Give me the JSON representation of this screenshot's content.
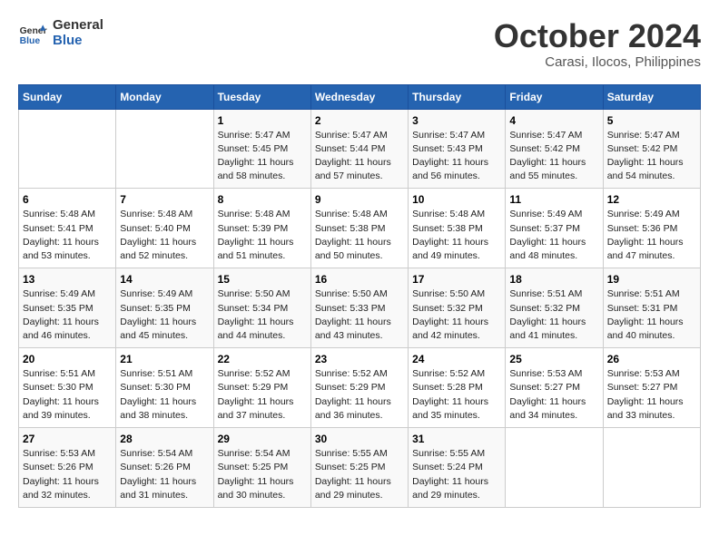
{
  "header": {
    "logo_line1": "General",
    "logo_line2": "Blue",
    "month_title": "October 2024",
    "location": "Carasi, Ilocos, Philippines"
  },
  "weekdays": [
    "Sunday",
    "Monday",
    "Tuesday",
    "Wednesday",
    "Thursday",
    "Friday",
    "Saturday"
  ],
  "weeks": [
    [
      {
        "day": "",
        "info": ""
      },
      {
        "day": "",
        "info": ""
      },
      {
        "day": "1",
        "info": "Sunrise: 5:47 AM\nSunset: 5:45 PM\nDaylight: 11 hours\nand 58 minutes."
      },
      {
        "day": "2",
        "info": "Sunrise: 5:47 AM\nSunset: 5:44 PM\nDaylight: 11 hours\nand 57 minutes."
      },
      {
        "day": "3",
        "info": "Sunrise: 5:47 AM\nSunset: 5:43 PM\nDaylight: 11 hours\nand 56 minutes."
      },
      {
        "day": "4",
        "info": "Sunrise: 5:47 AM\nSunset: 5:42 PM\nDaylight: 11 hours\nand 55 minutes."
      },
      {
        "day": "5",
        "info": "Sunrise: 5:47 AM\nSunset: 5:42 PM\nDaylight: 11 hours\nand 54 minutes."
      }
    ],
    [
      {
        "day": "6",
        "info": "Sunrise: 5:48 AM\nSunset: 5:41 PM\nDaylight: 11 hours\nand 53 minutes."
      },
      {
        "day": "7",
        "info": "Sunrise: 5:48 AM\nSunset: 5:40 PM\nDaylight: 11 hours\nand 52 minutes."
      },
      {
        "day": "8",
        "info": "Sunrise: 5:48 AM\nSunset: 5:39 PM\nDaylight: 11 hours\nand 51 minutes."
      },
      {
        "day": "9",
        "info": "Sunrise: 5:48 AM\nSunset: 5:38 PM\nDaylight: 11 hours\nand 50 minutes."
      },
      {
        "day": "10",
        "info": "Sunrise: 5:48 AM\nSunset: 5:38 PM\nDaylight: 11 hours\nand 49 minutes."
      },
      {
        "day": "11",
        "info": "Sunrise: 5:49 AM\nSunset: 5:37 PM\nDaylight: 11 hours\nand 48 minutes."
      },
      {
        "day": "12",
        "info": "Sunrise: 5:49 AM\nSunset: 5:36 PM\nDaylight: 11 hours\nand 47 minutes."
      }
    ],
    [
      {
        "day": "13",
        "info": "Sunrise: 5:49 AM\nSunset: 5:35 PM\nDaylight: 11 hours\nand 46 minutes."
      },
      {
        "day": "14",
        "info": "Sunrise: 5:49 AM\nSunset: 5:35 PM\nDaylight: 11 hours\nand 45 minutes."
      },
      {
        "day": "15",
        "info": "Sunrise: 5:50 AM\nSunset: 5:34 PM\nDaylight: 11 hours\nand 44 minutes."
      },
      {
        "day": "16",
        "info": "Sunrise: 5:50 AM\nSunset: 5:33 PM\nDaylight: 11 hours\nand 43 minutes."
      },
      {
        "day": "17",
        "info": "Sunrise: 5:50 AM\nSunset: 5:32 PM\nDaylight: 11 hours\nand 42 minutes."
      },
      {
        "day": "18",
        "info": "Sunrise: 5:51 AM\nSunset: 5:32 PM\nDaylight: 11 hours\nand 41 minutes."
      },
      {
        "day": "19",
        "info": "Sunrise: 5:51 AM\nSunset: 5:31 PM\nDaylight: 11 hours\nand 40 minutes."
      }
    ],
    [
      {
        "day": "20",
        "info": "Sunrise: 5:51 AM\nSunset: 5:30 PM\nDaylight: 11 hours\nand 39 minutes."
      },
      {
        "day": "21",
        "info": "Sunrise: 5:51 AM\nSunset: 5:30 PM\nDaylight: 11 hours\nand 38 minutes."
      },
      {
        "day": "22",
        "info": "Sunrise: 5:52 AM\nSunset: 5:29 PM\nDaylight: 11 hours\nand 37 minutes."
      },
      {
        "day": "23",
        "info": "Sunrise: 5:52 AM\nSunset: 5:29 PM\nDaylight: 11 hours\nand 36 minutes."
      },
      {
        "day": "24",
        "info": "Sunrise: 5:52 AM\nSunset: 5:28 PM\nDaylight: 11 hours\nand 35 minutes."
      },
      {
        "day": "25",
        "info": "Sunrise: 5:53 AM\nSunset: 5:27 PM\nDaylight: 11 hours\nand 34 minutes."
      },
      {
        "day": "26",
        "info": "Sunrise: 5:53 AM\nSunset: 5:27 PM\nDaylight: 11 hours\nand 33 minutes."
      }
    ],
    [
      {
        "day": "27",
        "info": "Sunrise: 5:53 AM\nSunset: 5:26 PM\nDaylight: 11 hours\nand 32 minutes."
      },
      {
        "day": "28",
        "info": "Sunrise: 5:54 AM\nSunset: 5:26 PM\nDaylight: 11 hours\nand 31 minutes."
      },
      {
        "day": "29",
        "info": "Sunrise: 5:54 AM\nSunset: 5:25 PM\nDaylight: 11 hours\nand 30 minutes."
      },
      {
        "day": "30",
        "info": "Sunrise: 5:55 AM\nSunset: 5:25 PM\nDaylight: 11 hours\nand 29 minutes."
      },
      {
        "day": "31",
        "info": "Sunrise: 5:55 AM\nSunset: 5:24 PM\nDaylight: 11 hours\nand 29 minutes."
      },
      {
        "day": "",
        "info": ""
      },
      {
        "day": "",
        "info": ""
      }
    ]
  ]
}
